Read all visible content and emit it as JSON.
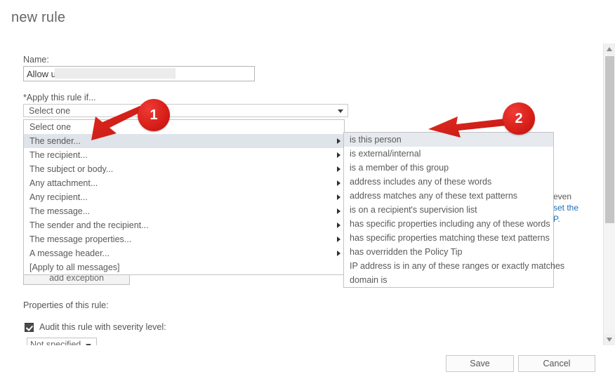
{
  "page": {
    "title": "new rule"
  },
  "form": {
    "name_label": "Name:",
    "name_value": "Allow u",
    "apply_label": "*Apply this rule if...",
    "combo_selected": "Select one",
    "add_exception_label": "add exception",
    "properties_label": "Properties of this rule:",
    "audit_checkbox_label": "Audit this rule with severity level:",
    "severity_value": "Not specified"
  },
  "dropdown": {
    "items": [
      {
        "label": "Select one",
        "has_submenu": false,
        "selected": false
      },
      {
        "label": "The sender...",
        "has_submenu": true,
        "selected": true
      },
      {
        "label": "The recipient...",
        "has_submenu": true,
        "selected": false
      },
      {
        "label": "The subject or body...",
        "has_submenu": true,
        "selected": false
      },
      {
        "label": "Any attachment...",
        "has_submenu": true,
        "selected": false
      },
      {
        "label": "Any recipient...",
        "has_submenu": true,
        "selected": false
      },
      {
        "label": "The message...",
        "has_submenu": true,
        "selected": false
      },
      {
        "label": "The sender and the recipient...",
        "has_submenu": true,
        "selected": false
      },
      {
        "label": "The message properties...",
        "has_submenu": true,
        "selected": false
      },
      {
        "label": "A message header...",
        "has_submenu": true,
        "selected": false
      },
      {
        "label": "[Apply to all messages]",
        "has_submenu": false,
        "selected": false
      }
    ]
  },
  "submenu": {
    "items": [
      {
        "label": "is this person",
        "selected": true
      },
      {
        "label": "is external/internal",
        "selected": false
      },
      {
        "label": "is a member of this group",
        "selected": false
      },
      {
        "label": "address includes any of these words",
        "selected": false
      },
      {
        "label": "address matches any of these text patterns",
        "selected": false
      },
      {
        "label": "is on a recipient's supervision list",
        "selected": false
      },
      {
        "label": "has specific properties including any of these words",
        "selected": false
      },
      {
        "label": "has specific properties matching these text patterns",
        "selected": false
      },
      {
        "label": "has overridden the Policy Tip",
        "selected": false
      },
      {
        "label": "IP address is in any of these ranges or exactly matches",
        "selected": false
      },
      {
        "label": "domain is",
        "selected": false
      }
    ]
  },
  "helper_text": {
    "line1": "even",
    "line2": "set the",
    "line3": "P."
  },
  "footer": {
    "save_label": "Save",
    "cancel_label": "Cancel"
  },
  "annotations": {
    "marker_1": "1",
    "marker_2": "2",
    "color": "#d81f18"
  }
}
